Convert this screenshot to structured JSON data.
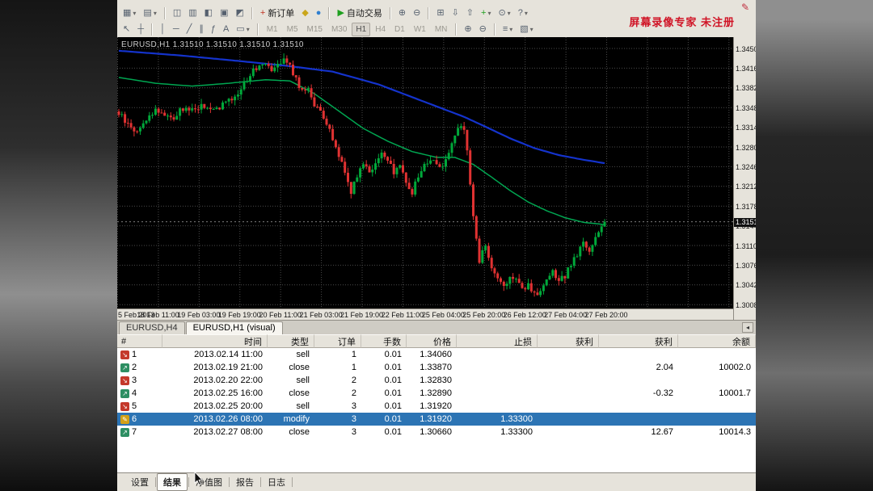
{
  "window": {
    "watermark": "屏幕录像专家 未注册"
  },
  "toolbar_main": {
    "items": [
      {
        "name": "new-chart",
        "glyph": "▦",
        "dropdown": true
      },
      {
        "name": "profiles",
        "glyph": "▤",
        "dropdown": true
      },
      {
        "type": "sep"
      },
      {
        "name": "market-watch",
        "glyph": "◫"
      },
      {
        "name": "data-window",
        "glyph": "▥"
      },
      {
        "name": "navigator",
        "glyph": "◧"
      },
      {
        "name": "terminal-panel",
        "glyph": "▣"
      },
      {
        "name": "strategy-tester",
        "glyph": "◩"
      },
      {
        "type": "sep"
      },
      {
        "name": "new-order",
        "glyph": "+",
        "label": "新订单",
        "glyph_color": "#c03322"
      },
      {
        "name": "metaeditor",
        "glyph": "◆",
        "glyph_color": "#caa61b"
      },
      {
        "name": "chat",
        "glyph": "●",
        "glyph_color": "#2f7fd0"
      },
      {
        "type": "sep"
      },
      {
        "name": "autotrading",
        "glyph": "▶",
        "label": "自动交易",
        "glyph_color": "#1fa01f"
      },
      {
        "type": "sep"
      },
      {
        "name": "zoom-in",
        "glyph": "⊕"
      },
      {
        "name": "zoom-out",
        "glyph": "⊖"
      },
      {
        "type": "sep"
      },
      {
        "name": "tile-windows",
        "glyph": "⊞"
      },
      {
        "name": "sort-descending",
        "glyph": "⇩"
      },
      {
        "name": "sort-ascending",
        "glyph": "⇧"
      },
      {
        "name": "add-indicator",
        "glyph": "+",
        "dropdown": true,
        "glyph_color": "#1fa01f"
      },
      {
        "name": "period-clock",
        "glyph": "⊙",
        "dropdown": true
      },
      {
        "name": "help",
        "glyph": "?",
        "dropdown": true
      }
    ]
  },
  "toolbar_drawing": {
    "active_timeframe": "H1",
    "items": [
      {
        "name": "cursor-tool",
        "glyph": "↖"
      },
      {
        "name": "crosshair-tool",
        "glyph": "┼"
      },
      {
        "type": "sep"
      },
      {
        "name": "vertical-line-tool",
        "glyph": "│"
      },
      {
        "name": "horizontal-line-tool",
        "glyph": "─"
      },
      {
        "name": "trendline-tool",
        "glyph": "╱"
      },
      {
        "name": "channel-tool",
        "glyph": "∥"
      },
      {
        "name": "fibonacci-tool",
        "glyph": "ƒ"
      },
      {
        "name": "text-tool",
        "glyph": "A"
      },
      {
        "name": "shapes-tool",
        "glyph": "▭",
        "dropdown": true
      },
      {
        "type": "sep"
      },
      {
        "type": "tf",
        "label": "M1"
      },
      {
        "type": "tf",
        "label": "M5"
      },
      {
        "type": "tf",
        "label": "M15"
      },
      {
        "type": "tf",
        "label": "M30"
      },
      {
        "type": "tf",
        "label": "H1"
      },
      {
        "type": "tf",
        "label": "H4"
      },
      {
        "type": "tf",
        "label": "D1"
      },
      {
        "type": "tf",
        "label": "W1"
      },
      {
        "type": "tf",
        "label": "MN"
      },
      {
        "type": "sep"
      },
      {
        "name": "zoom-in-2",
        "glyph": "⊕"
      },
      {
        "name": "zoom-out-2",
        "glyph": "⊖"
      },
      {
        "type": "sep"
      },
      {
        "name": "indicators-list",
        "glyph": "≡",
        "dropdown": true
      },
      {
        "name": "templates",
        "glyph": "▧",
        "dropdown": true
      }
    ]
  },
  "chart": {
    "symbol_label": "EURUSD,H1 1.31510 1.31510 1.31510 1.31510",
    "current_price": "1.3151",
    "current_price_value": 1.3151,
    "price_axis": {
      "max": 1.345,
      "min": 1.3008,
      "step": 0.0034
    },
    "price_labels": [
      "1.3450",
      "1.3416",
      "1.3382",
      "1.3348",
      "1.3314",
      "1.3280",
      "1.3246",
      "1.3212",
      "1.3178",
      "1.3144",
      "1.3110",
      "1.3076",
      "1.3042",
      "1.3008"
    ],
    "time_labels": [
      "5 Feb 2013",
      "18 Feb 11:00",
      "19 Feb 03:00",
      "19 Feb 19:00",
      "20 Feb 11:00",
      "21 Feb 03:00",
      "21 Feb 19:00",
      "22 Feb 11:00",
      "25 Feb 04:00",
      "25 Feb 20:00",
      "26 Feb 12:00",
      "27 Feb 04:00",
      "27 Feb 20:00"
    ],
    "colors": {
      "bg": "#000000",
      "grid": "#4a4a4a",
      "up": "#00a83a",
      "down": "#e03232",
      "ma_fast": "#00a651",
      "ma_slow": "#1433cc"
    },
    "chart_data": {
      "type": "candlestick",
      "symbol": "EURUSD",
      "timeframe": "H1",
      "candle_count": 160,
      "close_anchors": [
        [
          0,
          1.3338
        ],
        [
          3,
          1.3318
        ],
        [
          6,
          1.3306
        ],
        [
          9,
          1.3328
        ],
        [
          12,
          1.3344
        ],
        [
          15,
          1.3337
        ],
        [
          18,
          1.333
        ],
        [
          21,
          1.3347
        ],
        [
          24,
          1.3344
        ],
        [
          27,
          1.3351
        ],
        [
          30,
          1.3342
        ],
        [
          33,
          1.335
        ],
        [
          36,
          1.3358
        ],
        [
          39,
          1.3374
        ],
        [
          42,
          1.3398
        ],
        [
          45,
          1.3418
        ],
        [
          48,
          1.3428
        ],
        [
          50,
          1.3416
        ],
        [
          52,
          1.3426
        ],
        [
          54,
          1.3432
        ],
        [
          56,
          1.3419
        ],
        [
          58,
          1.3398
        ],
        [
          60,
          1.3374
        ],
        [
          62,
          1.3384
        ],
        [
          64,
          1.3354
        ],
        [
          66,
          1.3338
        ],
        [
          68,
          1.332
        ],
        [
          70,
          1.3293
        ],
        [
          72,
          1.3268
        ],
        [
          74,
          1.3238
        ],
        [
          76,
          1.3203
        ],
        [
          78,
          1.3233
        ],
        [
          80,
          1.3253
        ],
        [
          82,
          1.3238
        ],
        [
          84,
          1.3253
        ],
        [
          86,
          1.3268
        ],
        [
          88,
          1.3253
        ],
        [
          90,
          1.3238
        ],
        [
          92,
          1.3248
        ],
        [
          94,
          1.322
        ],
        [
          96,
          1.3203
        ],
        [
          98,
          1.3228
        ],
        [
          100,
          1.325
        ],
        [
          102,
          1.3258
        ],
        [
          104,
          1.3253
        ],
        [
          106,
          1.3248
        ],
        [
          108,
          1.3268
        ],
        [
          110,
          1.3298
        ],
        [
          112,
          1.3318
        ],
        [
          113,
          1.3308
        ],
        [
          114,
          1.3278
        ],
        [
          115,
          1.3218
        ],
        [
          116,
          1.3158
        ],
        [
          117,
          1.3118
        ],
        [
          118,
          1.3083
        ],
        [
          119,
          1.3098
        ],
        [
          120,
          1.3108
        ],
        [
          121,
          1.3093
        ],
        [
          122,
          1.3068
        ],
        [
          124,
          1.3053
        ],
        [
          126,
          1.304
        ],
        [
          128,
          1.3058
        ],
        [
          130,
          1.3048
        ],
        [
          132,
          1.3033
        ],
        [
          134,
          1.3043
        ],
        [
          136,
          1.3028
        ],
        [
          138,
          1.3026
        ],
        [
          140,
          1.3048
        ],
        [
          142,
          1.3063
        ],
        [
          144,
          1.3046
        ],
        [
          146,
          1.3058
        ],
        [
          148,
          1.3078
        ],
        [
          150,
          1.3096
        ],
        [
          152,
          1.3113
        ],
        [
          154,
          1.3098
        ],
        [
          156,
          1.3126
        ],
        [
          158,
          1.3143
        ],
        [
          159,
          1.3151
        ]
      ],
      "ma_fast_anchors": [
        [
          0,
          1.34
        ],
        [
          12,
          1.339
        ],
        [
          24,
          1.3385
        ],
        [
          36,
          1.339
        ],
        [
          48,
          1.3396
        ],
        [
          56,
          1.3394
        ],
        [
          64,
          1.3372
        ],
        [
          72,
          1.3342
        ],
        [
          80,
          1.3312
        ],
        [
          88,
          1.329
        ],
        [
          96,
          1.3272
        ],
        [
          104,
          1.3262
        ],
        [
          110,
          1.3262
        ],
        [
          116,
          1.325
        ],
        [
          122,
          1.3228
        ],
        [
          128,
          1.3205
        ],
        [
          134,
          1.3185
        ],
        [
          140,
          1.317
        ],
        [
          146,
          1.3158
        ],
        [
          152,
          1.315
        ],
        [
          159,
          1.3146
        ]
      ],
      "ma_slow_anchors": [
        [
          0,
          1.3446
        ],
        [
          20,
          1.3438
        ],
        [
          40,
          1.3428
        ],
        [
          55,
          1.342
        ],
        [
          70,
          1.341
        ],
        [
          85,
          1.3388
        ],
        [
          95,
          1.3368
        ],
        [
          105,
          1.3348
        ],
        [
          113,
          1.3332
        ],
        [
          120,
          1.3315
        ],
        [
          128,
          1.3295
        ],
        [
          136,
          1.3278
        ],
        [
          144,
          1.3266
        ],
        [
          152,
          1.3258
        ],
        [
          159,
          1.3252
        ]
      ]
    }
  },
  "chart_tabs": {
    "items": [
      {
        "label": "EURUSD,H4",
        "name": "chart-tab-eurusd-h4",
        "active": false
      },
      {
        "label": "EURUSD,H1 (visual)",
        "name": "chart-tab-eurusd-h1-visual",
        "active": true
      }
    ],
    "nav_left": "◂"
  },
  "terminal": {
    "columns": [
      "#",
      "时间",
      "类型",
      "订单",
      "手数",
      "价格",
      "止损",
      "获利",
      "获利",
      "余额"
    ],
    "rows": [
      {
        "num": "1",
        "icon": "sell",
        "time": "2013.02.14 11:00",
        "type": "sell",
        "order": "1",
        "lots": "0.01",
        "price": "1.34060",
        "sl": "",
        "tp": "",
        "profit": "",
        "balance": "",
        "selected": false
      },
      {
        "num": "2",
        "icon": "close",
        "time": "2013.02.19 21:00",
        "type": "close",
        "order": "1",
        "lots": "0.01",
        "price": "1.33870",
        "sl": "",
        "tp": "",
        "profit": "2.04",
        "balance": "10002.0",
        "selected": false
      },
      {
        "num": "3",
        "icon": "sell",
        "time": "2013.02.20 22:00",
        "type": "sell",
        "order": "2",
        "lots": "0.01",
        "price": "1.32830",
        "sl": "",
        "tp": "",
        "profit": "",
        "balance": "",
        "selected": false
      },
      {
        "num": "4",
        "icon": "close",
        "time": "2013.02.25 16:00",
        "type": "close",
        "order": "2",
        "lots": "0.01",
        "price": "1.32890",
        "sl": "",
        "tp": "",
        "profit": "-0.32",
        "balance": "10001.7",
        "selected": false
      },
      {
        "num": "5",
        "icon": "sell",
        "time": "2013.02.25 20:00",
        "type": "sell",
        "order": "3",
        "lots": "0.01",
        "price": "1.31920",
        "sl": "",
        "tp": "",
        "profit": "",
        "balance": "",
        "selected": false
      },
      {
        "num": "6",
        "icon": "modify",
        "time": "2013.02.26 08:00",
        "type": "modify",
        "order": "3",
        "lots": "0.01",
        "price": "1.31920",
        "sl": "1.33300",
        "tp": "",
        "profit": "",
        "balance": "",
        "selected": true
      },
      {
        "num": "7",
        "icon": "close",
        "time": "2013.02.27 08:00",
        "type": "close",
        "order": "3",
        "lots": "0.01",
        "price": "1.30660",
        "sl": "1.33300",
        "tp": "",
        "profit": "12.67",
        "balance": "10014.3",
        "selected": false
      }
    ]
  },
  "bottom_tabs": {
    "active": "结果",
    "items": [
      {
        "label": "设置",
        "name": "settings"
      },
      {
        "label": "结果",
        "name": "results"
      },
      {
        "label": "净值图",
        "name": "graph"
      },
      {
        "label": "报告",
        "name": "report"
      },
      {
        "label": "日志",
        "name": "journal"
      }
    ]
  }
}
